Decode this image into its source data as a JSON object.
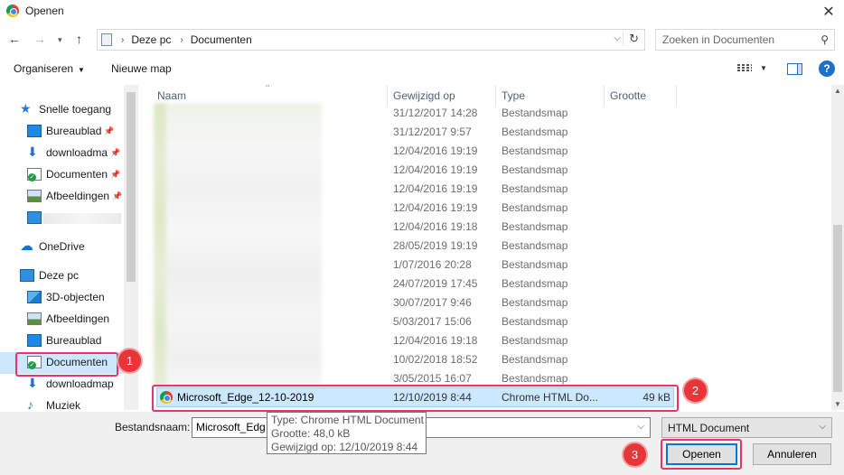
{
  "window": {
    "title": "Openen"
  },
  "address": {
    "crumbs": [
      "Deze pc",
      "Documenten"
    ]
  },
  "search": {
    "placeholder": "Zoeken in Documenten"
  },
  "toolbar": {
    "organize_label": "Organiseren",
    "new_folder_label": "Nieuwe map"
  },
  "sidebar": {
    "items": [
      {
        "label": "Snelle toegang"
      },
      {
        "label": "Bureaublad"
      },
      {
        "label": "downloadma"
      },
      {
        "label": "Documenten"
      },
      {
        "label": "Afbeeldingen"
      },
      {
        "label": "OneDrive"
      },
      {
        "label": "Deze pc"
      },
      {
        "label": "3D-objecten"
      },
      {
        "label": "Afbeeldingen"
      },
      {
        "label": "Bureaublad"
      },
      {
        "label": "Documenten"
      },
      {
        "label": "downloadmap"
      },
      {
        "label": "Muziek"
      }
    ]
  },
  "columns": {
    "name": "Naam",
    "modified": "Gewijzigd op",
    "type": "Type",
    "size": "Grootte"
  },
  "rows": [
    {
      "modified": "31/12/2017 14:28",
      "type": "Bestandsmap",
      "size": ""
    },
    {
      "modified": "31/12/2017 9:57",
      "type": "Bestandsmap",
      "size": ""
    },
    {
      "modified": "12/04/2016 19:19",
      "type": "Bestandsmap",
      "size": ""
    },
    {
      "modified": "12/04/2016 19:19",
      "type": "Bestandsmap",
      "size": ""
    },
    {
      "modified": "12/04/2016 19:19",
      "type": "Bestandsmap",
      "size": ""
    },
    {
      "modified": "12/04/2016 19:19",
      "type": "Bestandsmap",
      "size": ""
    },
    {
      "modified": "12/04/2016 19:18",
      "type": "Bestandsmap",
      "size": ""
    },
    {
      "modified": "28/05/2019 19:19",
      "type": "Bestandsmap",
      "size": ""
    },
    {
      "modified": "1/07/2016 20:28",
      "type": "Bestandsmap",
      "size": ""
    },
    {
      "modified": "24/07/2019 17:45",
      "type": "Bestandsmap",
      "size": ""
    },
    {
      "modified": "30/07/2017 9:46",
      "type": "Bestandsmap",
      "size": ""
    },
    {
      "modified": "5/03/2017 15:06",
      "type": "Bestandsmap",
      "size": ""
    },
    {
      "modified": "12/04/2016 19:18",
      "type": "Bestandsmap",
      "size": ""
    },
    {
      "modified": "10/02/2018 18:52",
      "type": "Bestandsmap",
      "size": ""
    },
    {
      "modified": "3/05/2015 16:07",
      "type": "Bestandsmap",
      "size": ""
    }
  ],
  "selected_file": {
    "name": "Microsoft_Edge_12-10-2019",
    "modified": "12/10/2019 8:44",
    "type": "Chrome HTML Do...",
    "size": "49 kB"
  },
  "tooltip": {
    "type": "Type: Chrome HTML Document",
    "size": "Grootte: 48,0 kB",
    "modified": "Gewijzigd op: 12/10/2019 8:44"
  },
  "filename": {
    "label": "Bestandsnaam:",
    "value": "Microsoft_Edg"
  },
  "filetype": {
    "value": "HTML Document"
  },
  "buttons": {
    "open": "Openen",
    "cancel": "Annuleren"
  },
  "markers": [
    "1",
    "2",
    "3"
  ],
  "colors": {
    "highlight": "#e8336c",
    "marker": "#e8353a",
    "selection": "#cce8ff",
    "accent": "#0078d7"
  },
  "icons": [
    "chrome-icon",
    "close-icon",
    "back-arrow-icon",
    "forward-arrow-icon",
    "up-arrow-icon",
    "refresh-icon",
    "search-icon",
    "view-options-icon",
    "preview-pane-icon",
    "help-icon"
  ]
}
